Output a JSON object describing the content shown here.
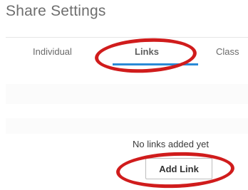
{
  "page": {
    "title": "Share Settings"
  },
  "tabs": [
    {
      "label": "Individual",
      "active": false
    },
    {
      "label": "Links",
      "active": true
    },
    {
      "label": "Class",
      "active": false
    }
  ],
  "links_panel": {
    "empty_message": "No links added yet",
    "add_button_label": "Add Link"
  },
  "colors": {
    "accent": "#2a8ad6",
    "annotation": "#d01c1c"
  }
}
